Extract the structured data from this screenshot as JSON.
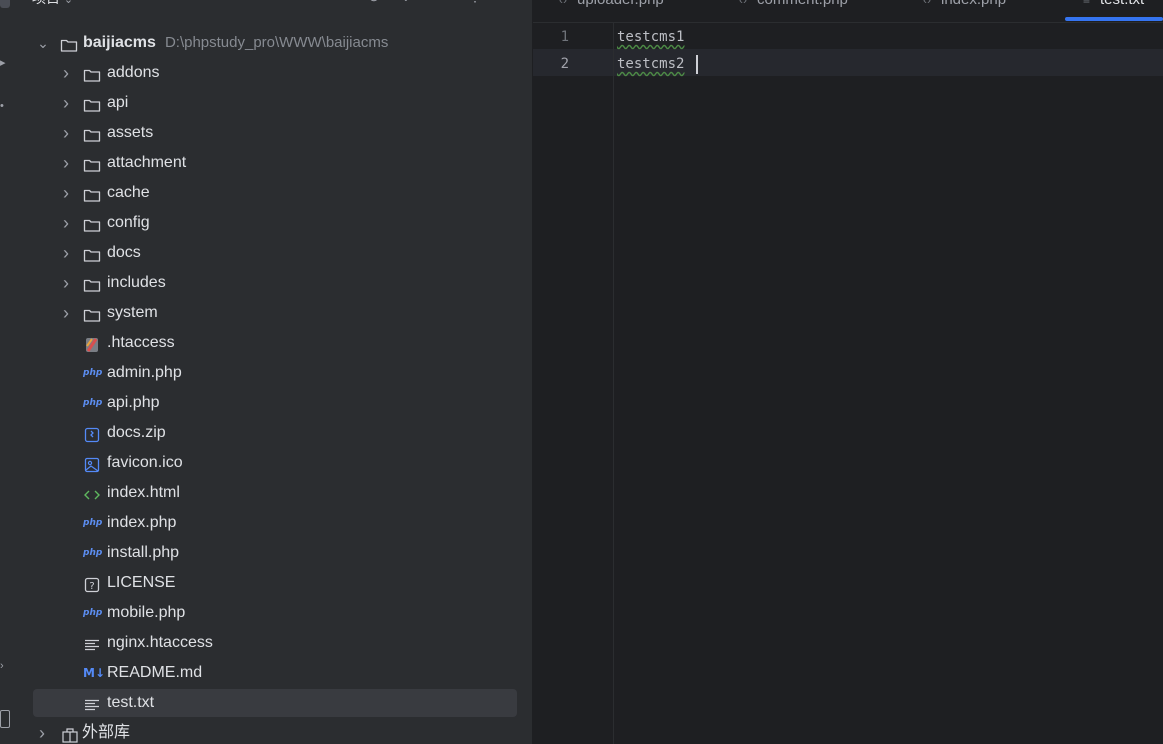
{
  "project_panel": {
    "title": "项目",
    "root": {
      "name": "baijiacms",
      "path": "D:\\phpstudy_pro\\WWW\\baijiacms"
    },
    "items": [
      {
        "label": "addons",
        "type": "folder"
      },
      {
        "label": "api",
        "type": "folder"
      },
      {
        "label": "assets",
        "type": "folder"
      },
      {
        "label": "attachment",
        "type": "folder"
      },
      {
        "label": "cache",
        "type": "folder"
      },
      {
        "label": "config",
        "type": "folder"
      },
      {
        "label": "docs",
        "type": "folder"
      },
      {
        "label": "includes",
        "type": "folder"
      },
      {
        "label": "system",
        "type": "folder"
      },
      {
        "label": ".htaccess",
        "type": "htaccess"
      },
      {
        "label": "admin.php",
        "type": "php"
      },
      {
        "label": "api.php",
        "type": "php"
      },
      {
        "label": "docs.zip",
        "type": "zip"
      },
      {
        "label": "favicon.ico",
        "type": "image"
      },
      {
        "label": "index.html",
        "type": "html"
      },
      {
        "label": "index.php",
        "type": "php"
      },
      {
        "label": "install.php",
        "type": "php"
      },
      {
        "label": "LICENSE",
        "type": "unknown"
      },
      {
        "label": "mobile.php",
        "type": "php"
      },
      {
        "label": "nginx.htaccess",
        "type": "text"
      },
      {
        "label": "README.md",
        "type": "markdown"
      },
      {
        "label": "test.txt",
        "type": "text",
        "selected": true
      }
    ],
    "external_libraries": "外部库",
    "php_icon_text": "php",
    "md_icon_text": "M↓"
  },
  "editor": {
    "tabs": [
      {
        "label": "uploader.php"
      },
      {
        "label": "comment.php"
      },
      {
        "label": "index.php"
      },
      {
        "label": "test.txt",
        "active": true
      }
    ],
    "line_numbers": [
      "1",
      "2"
    ],
    "lines": [
      "testcms1",
      "testcms2"
    ]
  },
  "colors": {
    "accent": "#3574f0",
    "panel_bg": "#2b2d30",
    "editor_bg": "#1e1f22",
    "selection": "#393b40"
  }
}
